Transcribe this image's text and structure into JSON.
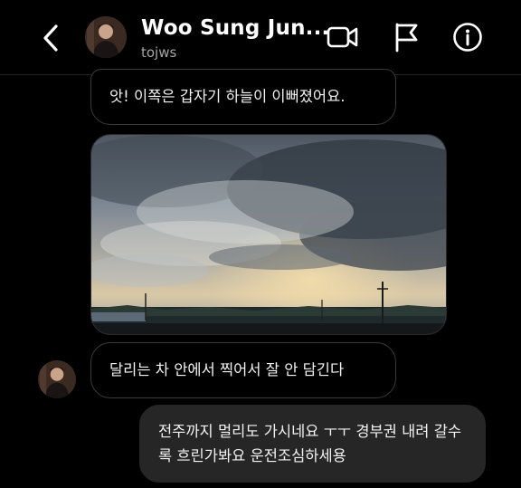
{
  "header": {
    "contact_name": "Woo Sung Jun...",
    "username": "tojws",
    "icons": [
      "chevron-left-icon",
      "video-camera-icon",
      "flag-icon",
      "info-icon"
    ]
  },
  "messages": [
    {
      "text": "앗! 이쪽은 갑자기 하늘이 이뻐졌어요.",
      "sender": "contact"
    },
    {
      "type": "photo",
      "sender": "contact"
    },
    {
      "text": "달리는 차 안에서 찍어서 잘 안 담긴다",
      "sender": "contact"
    },
    {
      "text": "전주까지 멀리도 가시네요 ㅜㅜ 경부권 내려 갈수록 흐린가봐요 운전조심하세용",
      "sender": "me"
    }
  ],
  "colors": {
    "background": "#000000",
    "outgoing_bubble": "#262626",
    "incoming_border": "#3a3a3a"
  }
}
